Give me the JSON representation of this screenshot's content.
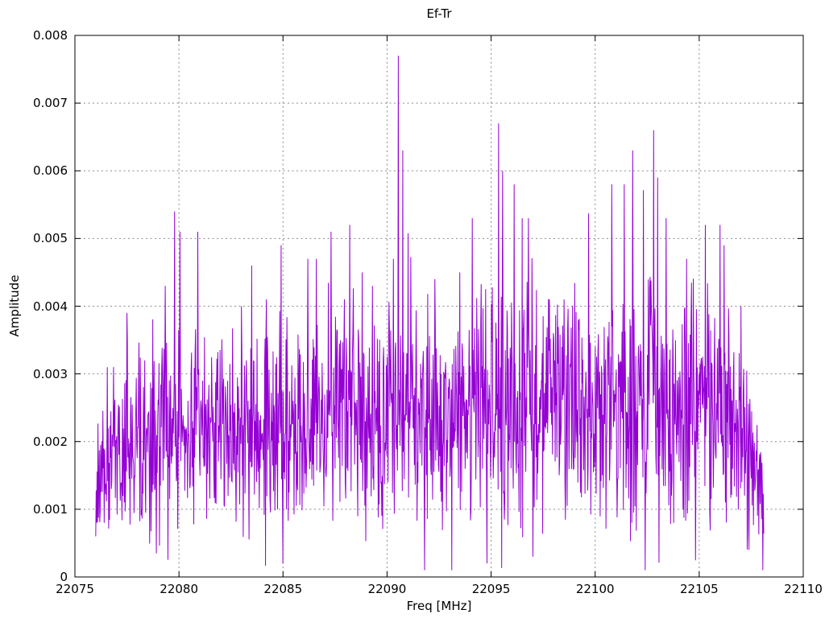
{
  "page": {
    "background": "#ffffff"
  },
  "chart_data": {
    "type": "line",
    "title": "Ef-Tr",
    "xlabel": "Freq [MHz]",
    "ylabel": "Amplitude",
    "xlim": [
      22075,
      22110
    ],
    "ylim": [
      0,
      0.008
    ],
    "x_ticks": [
      22075,
      22080,
      22085,
      22090,
      22095,
      22100,
      22105,
      22110
    ],
    "x_tick_labels": [
      "22075",
      "22080",
      "22085",
      "22090",
      "22095",
      "22100",
      "22105",
      "22110"
    ],
    "y_ticks": [
      0,
      0.001,
      0.002,
      0.003,
      0.004,
      0.005,
      0.006,
      0.007,
      0.008
    ],
    "y_tick_labels": [
      "0",
      "0.001",
      "0.002",
      "0.003",
      "0.004",
      "0.005",
      "0.006",
      "0.007",
      "0.008"
    ],
    "grid": true,
    "legend_position": "none",
    "line_color": "#9400D3",
    "grid_color": "#8a8a8a",
    "axis_color": "#000000",
    "series": [
      {
        "name": "Ef-Tr",
        "x_start": 22076.0,
        "x_end": 22108.1,
        "n_points": 1500,
        "noise": {
          "seed": 20,
          "base": 0.0004,
          "spread": 0.0042,
          "spike_prob": 0.04,
          "spike_extra": 0.002,
          "dip_prob": 0.012,
          "dip_factor": 0.12,
          "y_min": 5e-05,
          "y_max": 0.0078
        },
        "envelope": [
          [
            22076.0,
            0.45
          ],
          [
            22077.0,
            0.72
          ],
          [
            22079.0,
            0.85
          ],
          [
            22082.0,
            0.8
          ],
          [
            22085.0,
            0.85
          ],
          [
            22088.0,
            0.95
          ],
          [
            22091.0,
            0.92
          ],
          [
            22093.0,
            0.95
          ],
          [
            22095.0,
            1.0
          ],
          [
            22098.0,
            0.95
          ],
          [
            22100.0,
            0.9
          ],
          [
            22102.0,
            1.05
          ],
          [
            22104.0,
            1.0
          ],
          [
            22106.0,
            1.0
          ],
          [
            22107.3,
            0.8
          ],
          [
            22108.1,
            0.4
          ]
        ],
        "key_points": [
          [
            22076.0,
            0.0006
          ],
          [
            22076.55,
            0.0031
          ],
          [
            22077.5,
            0.0039
          ],
          [
            22079.35,
            0.0043
          ],
          [
            22079.8,
            0.0054
          ],
          [
            22080.05,
            0.0051
          ],
          [
            22080.9,
            0.0051
          ],
          [
            22083.0,
            0.004
          ],
          [
            22083.5,
            0.0046
          ],
          [
            22084.2,
            0.0041
          ],
          [
            22084.9,
            0.0049
          ],
          [
            22085.0,
            0.0002
          ],
          [
            22086.2,
            0.0047
          ],
          [
            22086.6,
            0.0047
          ],
          [
            22087.3,
            0.0051
          ],
          [
            22088.2,
            0.0052
          ],
          [
            22088.8,
            0.0045
          ],
          [
            22089.3,
            0.0043
          ],
          [
            22090.3,
            0.0047
          ],
          [
            22090.55,
            0.0077
          ],
          [
            22090.75,
            0.0063
          ],
          [
            22091.8,
            0.0001
          ],
          [
            22092.3,
            0.0044
          ],
          [
            22093.1,
            0.0001
          ],
          [
            22093.5,
            0.0045
          ],
          [
            22094.1,
            0.0053
          ],
          [
            22094.8,
            0.0002
          ],
          [
            22095.35,
            0.0067
          ],
          [
            22095.55,
            0.006
          ],
          [
            22096.1,
            0.0058
          ],
          [
            22096.5,
            0.0053
          ],
          [
            22096.8,
            0.0053
          ],
          [
            22097.0,
            0.0003
          ],
          [
            22097.8,
            0.0041
          ],
          [
            22098.5,
            0.0041
          ],
          [
            22100.8,
            0.0058
          ],
          [
            22101.4,
            0.0058
          ],
          [
            22101.8,
            0.0063
          ],
          [
            22102.4,
            0.0001
          ],
          [
            22102.8,
            0.0066
          ],
          [
            22103.0,
            0.0059
          ],
          [
            22103.4,
            0.0053
          ],
          [
            22104.4,
            0.0047
          ],
          [
            22105.3,
            0.0052
          ],
          [
            22106.0,
            0.0052
          ],
          [
            22106.2,
            0.0049
          ],
          [
            22107.0,
            0.004
          ],
          [
            22107.4,
            0.0004
          ],
          [
            22108.05,
            0.0001
          ]
        ]
      }
    ]
  }
}
